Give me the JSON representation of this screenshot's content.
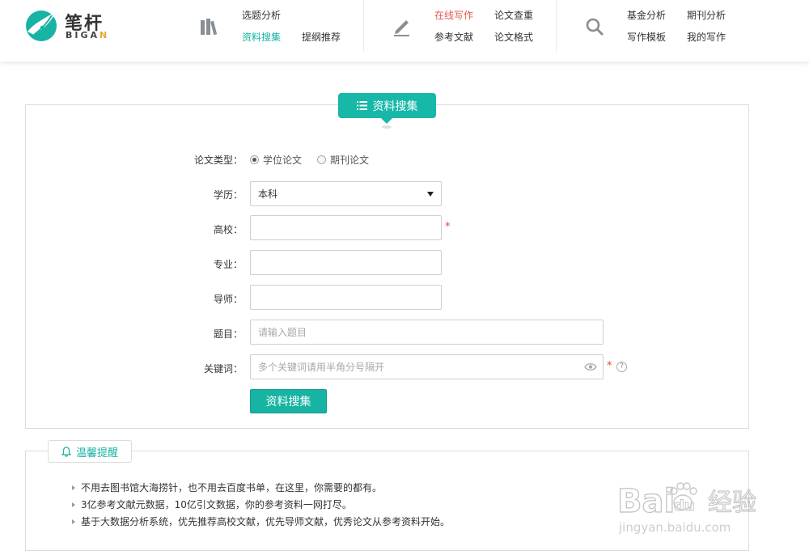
{
  "header": {
    "logo": {
      "name": "笔杆",
      "sub_prefix": "BIGA",
      "sub_accent": "N",
      "icon": "pen-nib-logo"
    },
    "groups": [
      {
        "icon": "books-icon",
        "links": [
          "选题分析",
          "资料搜集",
          "提纲推荐"
        ]
      },
      {
        "icon": "pencil-icon",
        "links": [
          "在线写作",
          "论文查重",
          "参考文献",
          "论文格式"
        ]
      },
      {
        "icon": "search-icon",
        "links": [
          "基金分析",
          "期刊分析",
          "写作模板",
          "我的写作"
        ]
      }
    ],
    "active_link": "资料搜集",
    "highlight_link": "在线写作"
  },
  "panel": {
    "title": "资料搜集",
    "title_icon": "list-icon",
    "type_label": "论文类型：",
    "type_options": [
      "学位论文",
      "期刊论文"
    ],
    "type_selected": "学位论文",
    "degree_label": "学历：",
    "degree_value": "本科",
    "school_label": "高校：",
    "school_value": "",
    "major_label": "专业：",
    "major_value": "",
    "advisor_label": "导师：",
    "advisor_value": "",
    "topic_label": "题目：",
    "topic_placeholder": "请输入题目",
    "keyword_label": "关键词：",
    "keyword_placeholder": "多个关键词请用半角分号隔开",
    "required_mark": "*",
    "help_mark": "?",
    "submit_label": "资料搜集"
  },
  "tips": {
    "title": "温馨提醒",
    "icon": "bell-icon",
    "lines": [
      "不用去图书馆大海捞针，也不用去百度书单，在这里，你需要的都有。",
      "3亿参考文献元数据，10亿引文数据，你的参考资料一网打尽。",
      "基于大数据分析系统，优先推荐高校文献，优先导师文献，优秀论文从参考资料开始。"
    ]
  },
  "watermark": {
    "brand": "Bai",
    "brand2": "du",
    "cn": "经验",
    "url": "jingyan.baidu.com"
  },
  "colors": {
    "accent": "#17b3a3",
    "hot": "#e25a4f",
    "required": "#e5443a"
  }
}
